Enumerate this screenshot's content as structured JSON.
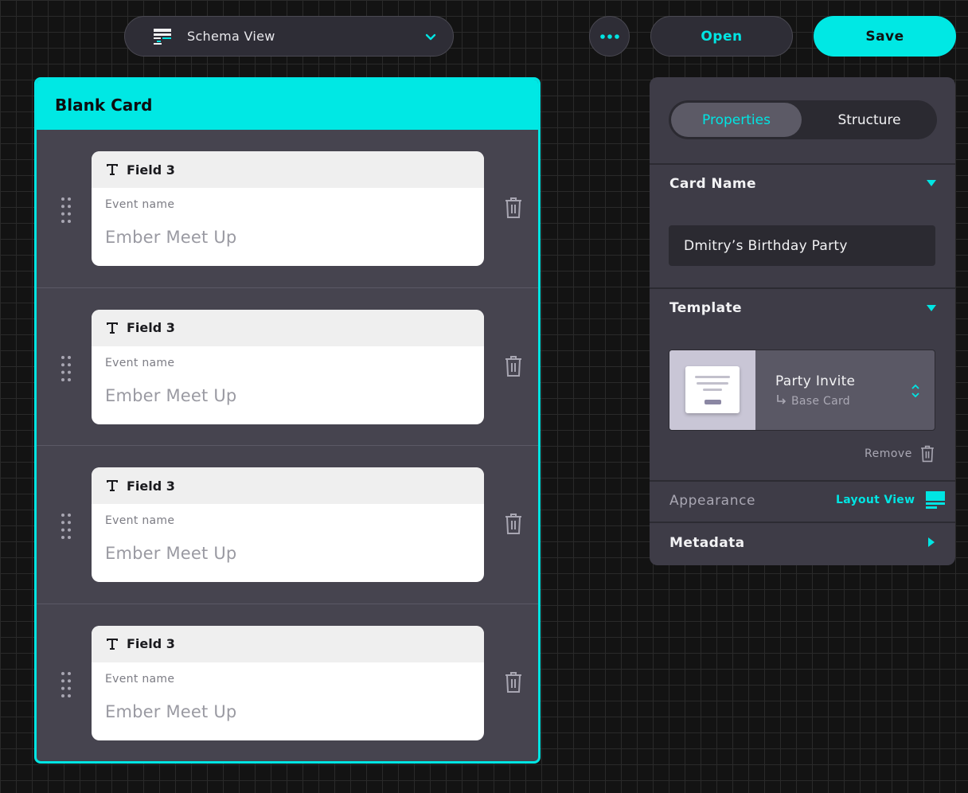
{
  "toolbar": {
    "view_select_value": "Schema View",
    "open_label": "Open",
    "save_label": "Save"
  },
  "card": {
    "title": "Blank Card",
    "fields": [
      {
        "type_label": "Field 3",
        "label": "Event name",
        "placeholder": "Ember Meet Up"
      },
      {
        "type_label": "Field 3",
        "label": "Event name",
        "placeholder": "Ember Meet Up"
      },
      {
        "type_label": "Field 3",
        "label": "Event name",
        "placeholder": "Ember Meet Up"
      },
      {
        "type_label": "Field 3",
        "label": "Event name",
        "placeholder": "Ember Meet Up"
      }
    ]
  },
  "panel": {
    "tabs": [
      {
        "label": "Properties",
        "active": true
      },
      {
        "label": "Structure",
        "active": false
      }
    ],
    "card_name": {
      "title": "Card Name",
      "value": "Dmitry’s Birthday Party"
    },
    "template": {
      "title": "Template",
      "name": "Party Invite",
      "base": "Base Card",
      "remove_label": "Remove"
    },
    "appearance": {
      "title": "Appearance",
      "link_label": "Layout View"
    },
    "metadata": {
      "title": "Metadata"
    }
  },
  "colors": {
    "accent": "#00e8e4",
    "background": "#131313",
    "card_body": "#46444f",
    "panel": "#3e3c47"
  },
  "icons": [
    "schema-icon",
    "chevron-down-icon",
    "more-icon",
    "text-type-icon",
    "drag-handle-icon",
    "trash-icon",
    "triangle-down-icon",
    "triangle-right-icon",
    "template-thumbnail",
    "stepper-icon",
    "layout-view-icon",
    "return-arrow-icon"
  ]
}
